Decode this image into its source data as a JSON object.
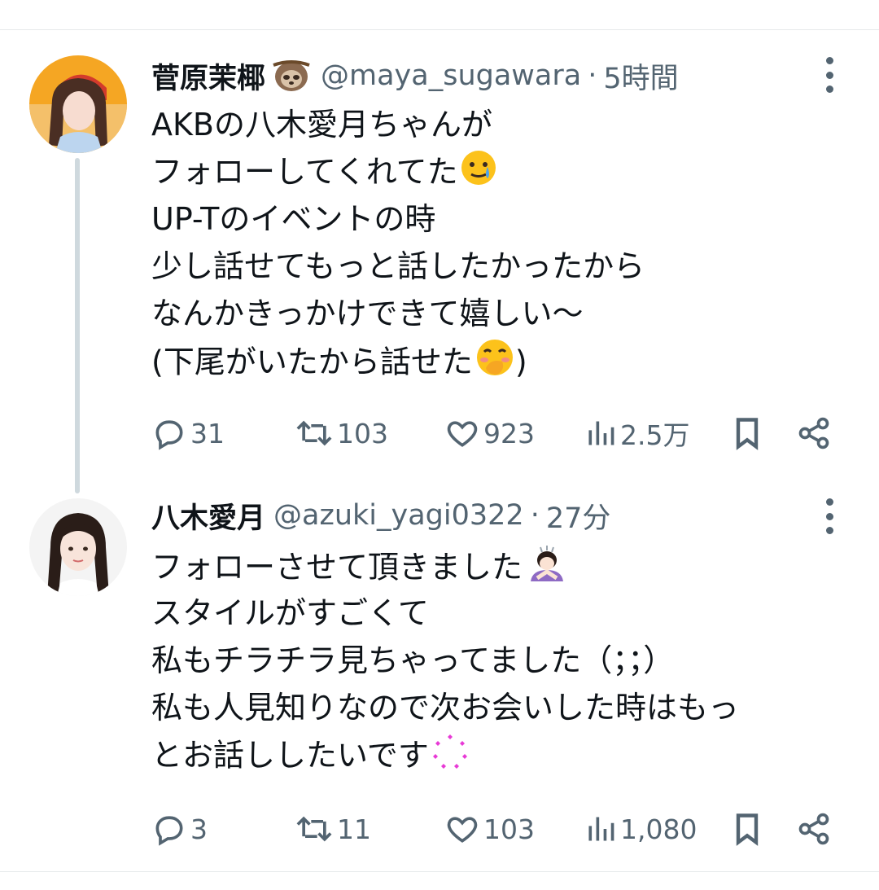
{
  "tweets": [
    {
      "name": "菅原茉椰",
      "handle": "@maya_sugawara",
      "sep": "·",
      "time": "5時間",
      "lines": [
        "AKBの八木愛月ちゃんが",
        "フォローしてくれてた",
        "UP-Tのイベントの時",
        "少し話せてもっと話したかったから",
        "なんかきっかけできて嬉しい〜",
        "(下尾がいたから話せた",
        ")"
      ],
      "replies": "31",
      "retweets": "103",
      "likes": "923",
      "views": "2.5万"
    },
    {
      "name": "八木愛月",
      "handle": "@azuki_yagi0322",
      "sep": "·",
      "time": "27分",
      "lines": [
        "フォローさせて頂きました",
        "スタイルがすごくて",
        "私もチラチラ見ちゃってました（；；）",
        "私も人見知りなので次お会いした時はもっ",
        "とお話ししたいです"
      ],
      "replies": "3",
      "retweets": "11",
      "likes": "103",
      "views": "1,080"
    }
  ],
  "colors": {
    "text": "#0f1419",
    "secondary": "#536471",
    "divider": "#e6e9eb",
    "thread": "#cfd9de"
  }
}
